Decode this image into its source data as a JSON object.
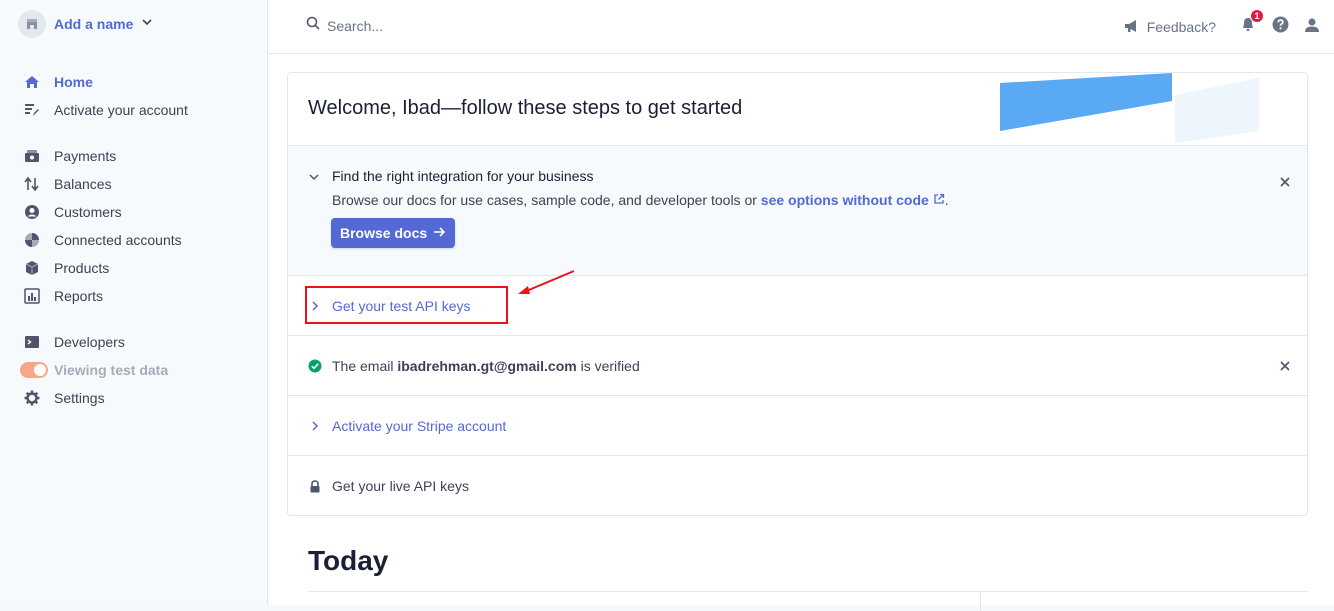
{
  "sidebar": {
    "account_name": "Add a name",
    "primary": [
      {
        "label": "Home",
        "icon": "home-icon",
        "active": true
      },
      {
        "label": "Activate your account",
        "icon": "edit-list-icon"
      }
    ],
    "main": [
      {
        "label": "Payments",
        "icon": "payments-icon"
      },
      {
        "label": "Balances",
        "icon": "balances-icon"
      },
      {
        "label": "Customers",
        "icon": "customers-icon"
      },
      {
        "label": "Connected accounts",
        "icon": "connected-accounts-icon"
      },
      {
        "label": "Products",
        "icon": "products-icon"
      },
      {
        "label": "Reports",
        "icon": "reports-icon"
      }
    ],
    "bottom": [
      {
        "label": "Developers",
        "icon": "terminal-icon"
      },
      {
        "label": "Viewing test data",
        "icon": "toggle"
      },
      {
        "label": "Settings",
        "icon": "gear-icon"
      }
    ]
  },
  "topbar": {
    "search_placeholder": "Search...",
    "feedback_label": "Feedback?",
    "notification_count": "1"
  },
  "welcome": {
    "title": "Welcome, Ibad—follow these steps to get started"
  },
  "integration": {
    "title": "Find the right integration for your business",
    "description": "Browse our docs for use cases, sample code, and developer tools or ",
    "link": "see options without code",
    "description_end": ".",
    "button": "Browse docs"
  },
  "steps": {
    "test_keys": "Get your test API keys",
    "email_prefix": "The email ",
    "email": "ibadrehman.gt@gmail.com",
    "email_suffix": " is verified",
    "activate": "Activate your Stripe account",
    "live_keys": "Get your live API keys"
  },
  "today": {
    "heading": "Today"
  },
  "colors": {
    "accent": "#5469d4",
    "success": "#09a36a",
    "highlight": "#e8131b",
    "toggle": "#f5a788"
  }
}
